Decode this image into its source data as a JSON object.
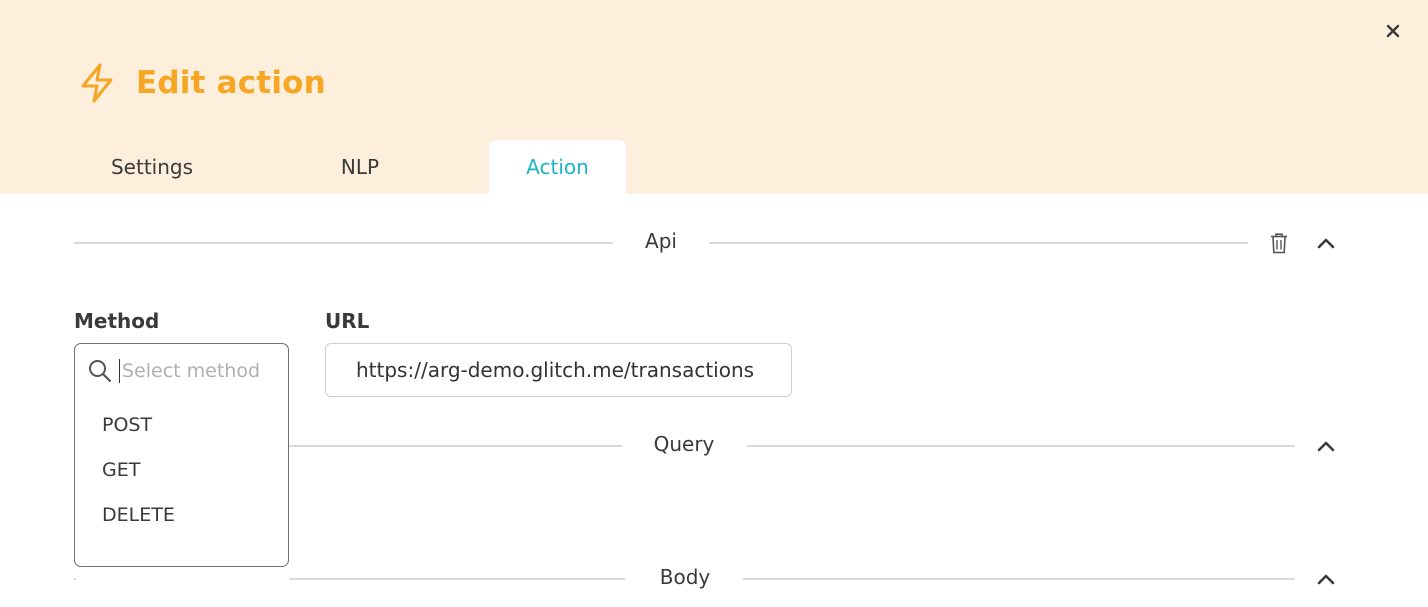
{
  "header": {
    "title": "Edit action",
    "close_icon": "close-icon",
    "title_icon": "lightning-icon",
    "accent_color": "#f5a623",
    "background": "#fdefdc"
  },
  "tabs": [
    {
      "label": "Settings",
      "active": false
    },
    {
      "label": "NLP",
      "active": false
    },
    {
      "label": "Action",
      "active": true
    }
  ],
  "tab_active_color": "#1bb5c4",
  "sections": {
    "api": {
      "label": "Api",
      "delete_icon": "trash-icon",
      "collapse_icon": "chevron-up-icon"
    },
    "query": {
      "label": "Query",
      "collapse_icon": "chevron-up-icon"
    },
    "body": {
      "label": "Body",
      "collapse_icon": "chevron-up-icon"
    }
  },
  "method": {
    "label": "Method",
    "search_placeholder": "Select method",
    "search_icon": "search-icon",
    "options": [
      "POST",
      "GET",
      "DELETE"
    ]
  },
  "url": {
    "label": "URL",
    "value": "https://arg-demo.glitch.me/transactions"
  }
}
